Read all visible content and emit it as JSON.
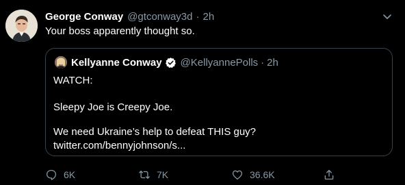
{
  "tweet": {
    "author_name": "George Conway",
    "author_handle": "@gtconway3d",
    "separator": "·",
    "time": "2h",
    "text": "Your boss apparently thought so."
  },
  "quote": {
    "author_name": "Kellyanne Conway",
    "author_handle": "@KellyannePolls",
    "separator": "·",
    "time": "2h",
    "lines": [
      "WATCH:",
      "Sleepy Joe is Creepy Joe.",
      "We need Ukraine’s help to defeat THIS guy?",
      "twitter.com/bennyjohnson/s..."
    ]
  },
  "actions": {
    "reply_count": "6K",
    "retweet_count": "7K",
    "like_count": "36.6K"
  },
  "icons": {
    "more": "chevron-down-icon",
    "verified": "verified-badge-icon",
    "reply": "reply-icon",
    "retweet": "retweet-icon",
    "like": "heart-icon",
    "share": "share-icon"
  },
  "colors": {
    "background": "#000000",
    "text_primary": "#ffffff",
    "text_secondary": "#8899a6",
    "border": "#38444d"
  }
}
